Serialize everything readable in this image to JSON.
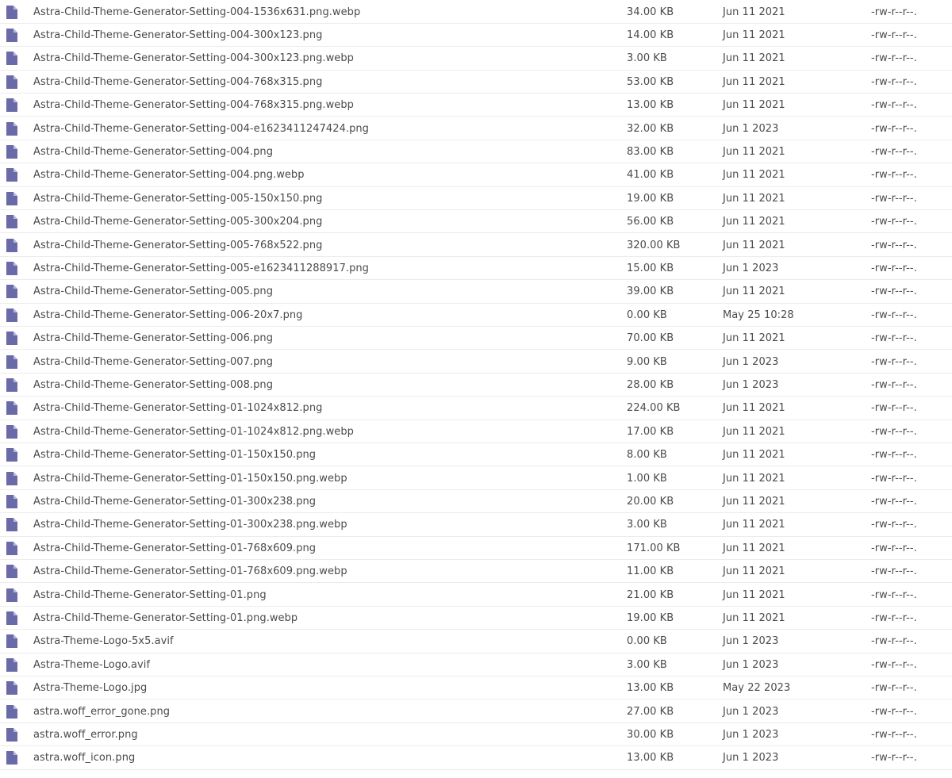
{
  "icon": {
    "name": "file-icon",
    "color": "#6b6aa8"
  },
  "files": [
    {
      "name": "Astra-Child-Theme-Generator-Setting-004-1536x631.png.webp",
      "size": "34.00 KB",
      "date": "Jun 11 2021",
      "perms": "-rw-r--r--."
    },
    {
      "name": "Astra-Child-Theme-Generator-Setting-004-300x123.png",
      "size": "14.00 KB",
      "date": "Jun 11 2021",
      "perms": "-rw-r--r--."
    },
    {
      "name": "Astra-Child-Theme-Generator-Setting-004-300x123.png.webp",
      "size": "3.00 KB",
      "date": "Jun 11 2021",
      "perms": "-rw-r--r--."
    },
    {
      "name": "Astra-Child-Theme-Generator-Setting-004-768x315.png",
      "size": "53.00 KB",
      "date": "Jun 11 2021",
      "perms": "-rw-r--r--."
    },
    {
      "name": "Astra-Child-Theme-Generator-Setting-004-768x315.png.webp",
      "size": "13.00 KB",
      "date": "Jun 11 2021",
      "perms": "-rw-r--r--."
    },
    {
      "name": "Astra-Child-Theme-Generator-Setting-004-e1623411247424.png",
      "size": "32.00 KB",
      "date": "Jun 1 2023",
      "perms": "-rw-r--r--."
    },
    {
      "name": "Astra-Child-Theme-Generator-Setting-004.png",
      "size": "83.00 KB",
      "date": "Jun 11 2021",
      "perms": "-rw-r--r--."
    },
    {
      "name": "Astra-Child-Theme-Generator-Setting-004.png.webp",
      "size": "41.00 KB",
      "date": "Jun 11 2021",
      "perms": "-rw-r--r--."
    },
    {
      "name": "Astra-Child-Theme-Generator-Setting-005-150x150.png",
      "size": "19.00 KB",
      "date": "Jun 11 2021",
      "perms": "-rw-r--r--."
    },
    {
      "name": "Astra-Child-Theme-Generator-Setting-005-300x204.png",
      "size": "56.00 KB",
      "date": "Jun 11 2021",
      "perms": "-rw-r--r--."
    },
    {
      "name": "Astra-Child-Theme-Generator-Setting-005-768x522.png",
      "size": "320.00 KB",
      "date": "Jun 11 2021",
      "perms": "-rw-r--r--."
    },
    {
      "name": "Astra-Child-Theme-Generator-Setting-005-e1623411288917.png",
      "size": "15.00 KB",
      "date": "Jun 1 2023",
      "perms": "-rw-r--r--."
    },
    {
      "name": "Astra-Child-Theme-Generator-Setting-005.png",
      "size": "39.00 KB",
      "date": "Jun 11 2021",
      "perms": "-rw-r--r--."
    },
    {
      "name": "Astra-Child-Theme-Generator-Setting-006-20x7.png",
      "size": "0.00 KB",
      "date": "May 25 10:28",
      "perms": "-rw-r--r--."
    },
    {
      "name": "Astra-Child-Theme-Generator-Setting-006.png",
      "size": "70.00 KB",
      "date": "Jun 11 2021",
      "perms": "-rw-r--r--."
    },
    {
      "name": "Astra-Child-Theme-Generator-Setting-007.png",
      "size": "9.00 KB",
      "date": "Jun 1 2023",
      "perms": "-rw-r--r--."
    },
    {
      "name": "Astra-Child-Theme-Generator-Setting-008.png",
      "size": "28.00 KB",
      "date": "Jun 1 2023",
      "perms": "-rw-r--r--."
    },
    {
      "name": "Astra-Child-Theme-Generator-Setting-01-1024x812.png",
      "size": "224.00 KB",
      "date": "Jun 11 2021",
      "perms": "-rw-r--r--."
    },
    {
      "name": "Astra-Child-Theme-Generator-Setting-01-1024x812.png.webp",
      "size": "17.00 KB",
      "date": "Jun 11 2021",
      "perms": "-rw-r--r--."
    },
    {
      "name": "Astra-Child-Theme-Generator-Setting-01-150x150.png",
      "size": "8.00 KB",
      "date": "Jun 11 2021",
      "perms": "-rw-r--r--."
    },
    {
      "name": "Astra-Child-Theme-Generator-Setting-01-150x150.png.webp",
      "size": "1.00 KB",
      "date": "Jun 11 2021",
      "perms": "-rw-r--r--."
    },
    {
      "name": "Astra-Child-Theme-Generator-Setting-01-300x238.png",
      "size": "20.00 KB",
      "date": "Jun 11 2021",
      "perms": "-rw-r--r--."
    },
    {
      "name": "Astra-Child-Theme-Generator-Setting-01-300x238.png.webp",
      "size": "3.00 KB",
      "date": "Jun 11 2021",
      "perms": "-rw-r--r--."
    },
    {
      "name": "Astra-Child-Theme-Generator-Setting-01-768x609.png",
      "size": "171.00 KB",
      "date": "Jun 11 2021",
      "perms": "-rw-r--r--."
    },
    {
      "name": "Astra-Child-Theme-Generator-Setting-01-768x609.png.webp",
      "size": "11.00 KB",
      "date": "Jun 11 2021",
      "perms": "-rw-r--r--."
    },
    {
      "name": "Astra-Child-Theme-Generator-Setting-01.png",
      "size": "21.00 KB",
      "date": "Jun 11 2021",
      "perms": "-rw-r--r--."
    },
    {
      "name": "Astra-Child-Theme-Generator-Setting-01.png.webp",
      "size": "19.00 KB",
      "date": "Jun 11 2021",
      "perms": "-rw-r--r--."
    },
    {
      "name": "Astra-Theme-Logo-5x5.avif",
      "size": "0.00 KB",
      "date": "Jun 1 2023",
      "perms": "-rw-r--r--."
    },
    {
      "name": "Astra-Theme-Logo.avif",
      "size": "3.00 KB",
      "date": "Jun 1 2023",
      "perms": "-rw-r--r--."
    },
    {
      "name": "Astra-Theme-Logo.jpg",
      "size": "13.00 KB",
      "date": "May 22 2023",
      "perms": "-rw-r--r--."
    },
    {
      "name": "astra.woff_error_gone.png",
      "size": "27.00 KB",
      "date": "Jun 1 2023",
      "perms": "-rw-r--r--."
    },
    {
      "name": "astra.woff_error.png",
      "size": "30.00 KB",
      "date": "Jun 1 2023",
      "perms": "-rw-r--r--."
    },
    {
      "name": "astra.woff_icon.png",
      "size": "13.00 KB",
      "date": "Jun 1 2023",
      "perms": "-rw-r--r--."
    }
  ]
}
